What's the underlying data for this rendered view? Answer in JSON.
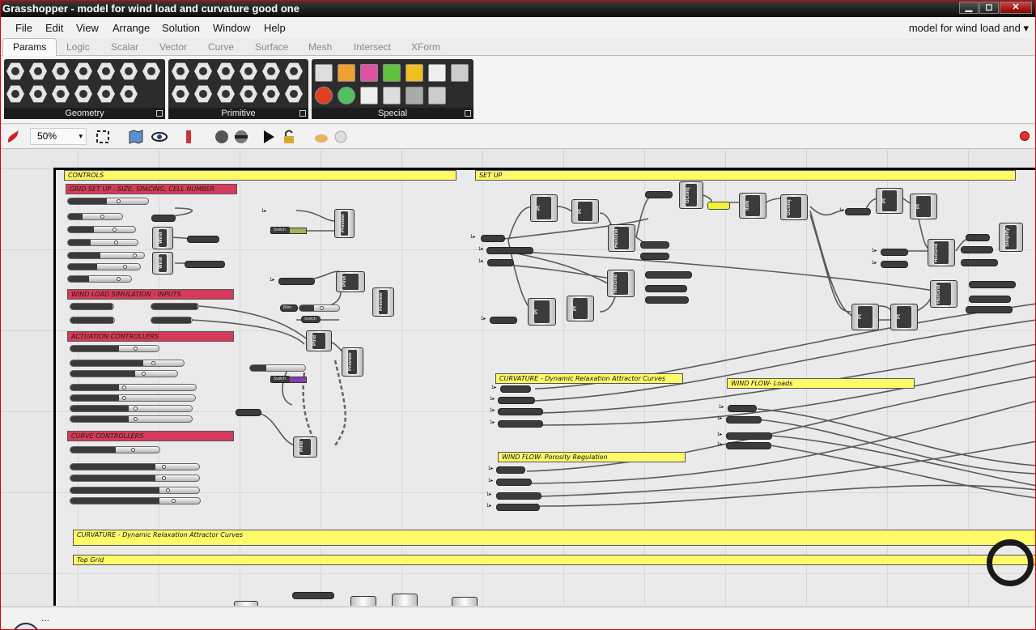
{
  "window": {
    "title": "Grasshopper - model for wind load and curvature good one",
    "minimize": "▁",
    "maximize": "◻",
    "close": "✕"
  },
  "menu": [
    "File",
    "Edit",
    "View",
    "Arrange",
    "Solution",
    "Window",
    "Help"
  ],
  "document_selector": "model for wind load and",
  "tabs": [
    "Params",
    "Logic",
    "Scalar",
    "Vector",
    "Curve",
    "Surface",
    "Mesh",
    "Intersect",
    "XForm"
  ],
  "ribbon_groups": [
    "Geometry",
    "Primitive",
    "Special"
  ],
  "toolbar": {
    "zoom": "50%"
  },
  "colors": {
    "group_yellow": "#fdfa6a",
    "group_red": "#d63a5c",
    "wire": "#5a5a5a",
    "status_red": "#e53030"
  },
  "groups": {
    "controls": "CONTROLS",
    "setup": "SET UP",
    "grid_setup": "GRID SET UP - SIZE, SPACING, CELL NUMBER",
    "wind_inputs": "WIND LOAD SIMULATION - INPUTS",
    "actuation": "ACTUATION CONTROLLERS",
    "curve_controllers": "CURVE CONTROLLERS",
    "curvature_attractors": "CURVATURE - Dynamic Relaxation Attractor Curves",
    "wind_loads": "WIND FLOW- Loads",
    "porosity": "WIND FLOW- Porosity Regulation",
    "curvature_bottom": "CURVATURE - Dynamic Relaxation Attractor Curves",
    "top_grid": "Top Grid"
  },
  "components": {
    "preview": "Preview",
    "pt": "Pt",
    "plnd": "Plnd",
    "hexgrid": "HexGrid",
    "item": "Item",
    "geomj": "GComj",
    "simplify": "Simplify",
    "wind": "Wind"
  },
  "switches": {
    "switch": "Switch",
    "bitm": "Bitm"
  },
  "status": {
    "text": "..."
  }
}
